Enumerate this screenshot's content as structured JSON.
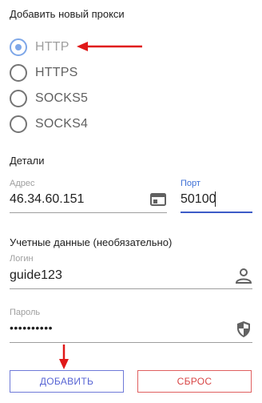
{
  "add_proxy": {
    "title": "Добавить новый прокси",
    "protocols": [
      {
        "label": "HTTP",
        "selected": true
      },
      {
        "label": "HTTPS",
        "selected": false
      },
      {
        "label": "SOCKS5",
        "selected": false
      },
      {
        "label": "SOCKS4",
        "selected": false
      }
    ]
  },
  "details": {
    "title": "Детали",
    "address_label": "Адрес",
    "address_value": "46.34.60.151",
    "port_label": "Порт",
    "port_value": "50100"
  },
  "credentials": {
    "title": "Учетные данные (необязательно)",
    "login_label": "Логин",
    "login_value": "guide123",
    "password_label": "Пароль",
    "password_value": "••••••••••"
  },
  "buttons": {
    "add_label": "ДОБАВИТЬ",
    "reset_label": "СБРОС"
  },
  "colors": {
    "radio_selected": "#7ea7e8",
    "focus_accent": "#3d5cc7",
    "add_button": "#5865d4",
    "reset_button": "#d84545",
    "annotation_arrow": "#e01818"
  },
  "icons": {
    "address": "card-icon",
    "login": "person-icon",
    "password": "shield-icon"
  }
}
